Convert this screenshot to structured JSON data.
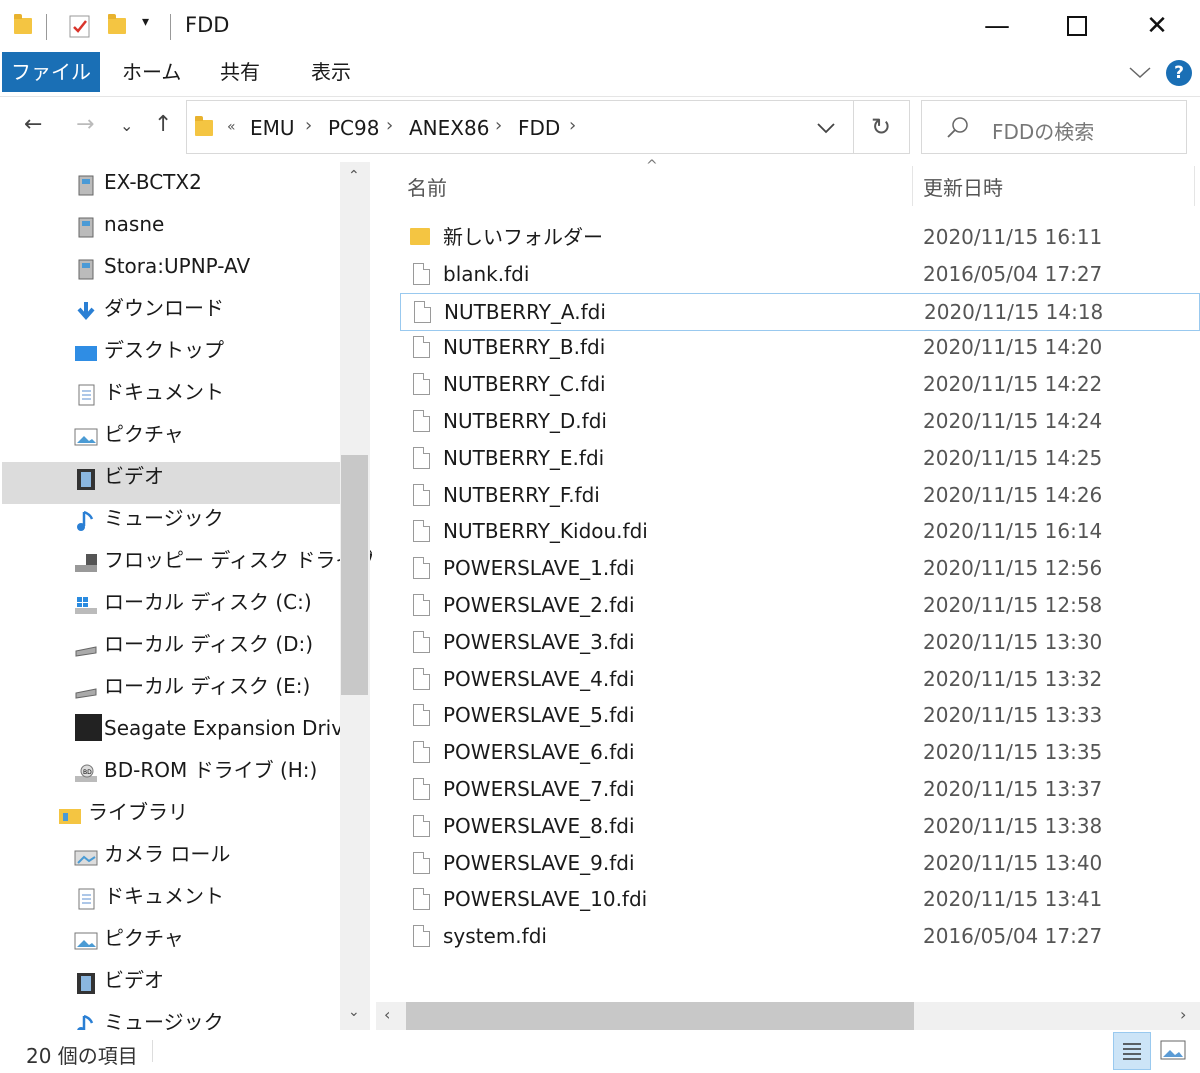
{
  "window": {
    "title": "FDD"
  },
  "ribbon": {
    "tabs": [
      {
        "label": "ファイル"
      },
      {
        "label": "ホーム"
      },
      {
        "label": "共有"
      },
      {
        "label": "表示"
      }
    ]
  },
  "address": {
    "overflow": "«",
    "crumbs": [
      {
        "label": "EMU"
      },
      {
        "label": "PC98"
      },
      {
        "label": "ANEX86"
      },
      {
        "label": "FDD"
      }
    ]
  },
  "search": {
    "placeholder": "FDDの検索"
  },
  "nav": {
    "items": [
      {
        "label": "EX-BCTX2",
        "icon": "network-device-icon"
      },
      {
        "label": "nasne",
        "icon": "network-device-icon"
      },
      {
        "label": "Stora:UPNP-AV",
        "icon": "network-device-icon"
      },
      {
        "label": "ダウンロード",
        "icon": "download-icon"
      },
      {
        "label": "デスクトップ",
        "icon": "desktop-icon"
      },
      {
        "label": "ドキュメント",
        "icon": "document-icon"
      },
      {
        "label": "ピクチャ",
        "icon": "picture-icon"
      },
      {
        "label": "ビデオ",
        "icon": "video-icon"
      },
      {
        "label": "ミュージック",
        "icon": "music-icon"
      },
      {
        "label": "フロッピー ディスク ドライブ (A:)",
        "icon": "floppy-drive-icon"
      },
      {
        "label": "ローカル ディスク (C:)",
        "icon": "windows-drive-icon"
      },
      {
        "label": "ローカル ディスク (D:)",
        "icon": "drive-icon"
      },
      {
        "label": "ローカル ディスク (E:)",
        "icon": "drive-icon"
      },
      {
        "label": "Seagate Expansion Drive",
        "icon": "external-drive-icon"
      },
      {
        "label": "BD-ROM ドライブ (H:)",
        "icon": "bd-drive-icon"
      },
      {
        "label": "ライブラリ",
        "icon": "library-icon"
      },
      {
        "label": "カメラ ロール",
        "icon": "camera-roll-icon"
      },
      {
        "label": "ドキュメント",
        "icon": "document-icon"
      },
      {
        "label": "ピクチャ",
        "icon": "picture-icon"
      },
      {
        "label": "ビデオ",
        "icon": "video-icon"
      },
      {
        "label": "ミュージック",
        "icon": "music-icon"
      }
    ]
  },
  "columns": {
    "name": "名前",
    "date": "更新日時"
  },
  "files": [
    {
      "name": "新しいフォルダー",
      "date": "2020/11/15 16:11",
      "type": "folder"
    },
    {
      "name": "blank.fdi",
      "date": "2016/05/04 17:27",
      "type": "file"
    },
    {
      "name": "NUTBERRY_A.fdi",
      "date": "2020/11/15 14:18",
      "type": "file"
    },
    {
      "name": "NUTBERRY_B.fdi",
      "date": "2020/11/15 14:20",
      "type": "file"
    },
    {
      "name": "NUTBERRY_C.fdi",
      "date": "2020/11/15 14:22",
      "type": "file"
    },
    {
      "name": "NUTBERRY_D.fdi",
      "date": "2020/11/15 14:24",
      "type": "file"
    },
    {
      "name": "NUTBERRY_E.fdi",
      "date": "2020/11/15 14:25",
      "type": "file"
    },
    {
      "name": "NUTBERRY_F.fdi",
      "date": "2020/11/15 14:26",
      "type": "file"
    },
    {
      "name": "NUTBERRY_Kidou.fdi",
      "date": "2020/11/15 16:14",
      "type": "file"
    },
    {
      "name": "POWERSLAVE_1.fdi",
      "date": "2020/11/15 12:56",
      "type": "file"
    },
    {
      "name": "POWERSLAVE_2.fdi",
      "date": "2020/11/15 12:58",
      "type": "file"
    },
    {
      "name": "POWERSLAVE_3.fdi",
      "date": "2020/11/15 13:30",
      "type": "file"
    },
    {
      "name": "POWERSLAVE_4.fdi",
      "date": "2020/11/15 13:32",
      "type": "file"
    },
    {
      "name": "POWERSLAVE_5.fdi",
      "date": "2020/11/15 13:33",
      "type": "file"
    },
    {
      "name": "POWERSLAVE_6.fdi",
      "date": "2020/11/15 13:35",
      "type": "file"
    },
    {
      "name": "POWERSLAVE_7.fdi",
      "date": "2020/11/15 13:37",
      "type": "file"
    },
    {
      "name": "POWERSLAVE_8.fdi",
      "date": "2020/11/15 13:38",
      "type": "file"
    },
    {
      "name": "POWERSLAVE_9.fdi",
      "date": "2020/11/15 13:40",
      "type": "file"
    },
    {
      "name": "POWERSLAVE_10.fdi",
      "date": "2020/11/15 13:41",
      "type": "file"
    },
    {
      "name": "system.fdi",
      "date": "2016/05/04 17:27",
      "type": "file"
    }
  ],
  "status": {
    "count": "20 個の項目"
  },
  "colors": {
    "accent": "#1a6fb5",
    "selection": "#dcdcdc",
    "hover_border": "#99c9ef",
    "folder": "#f4c542"
  }
}
